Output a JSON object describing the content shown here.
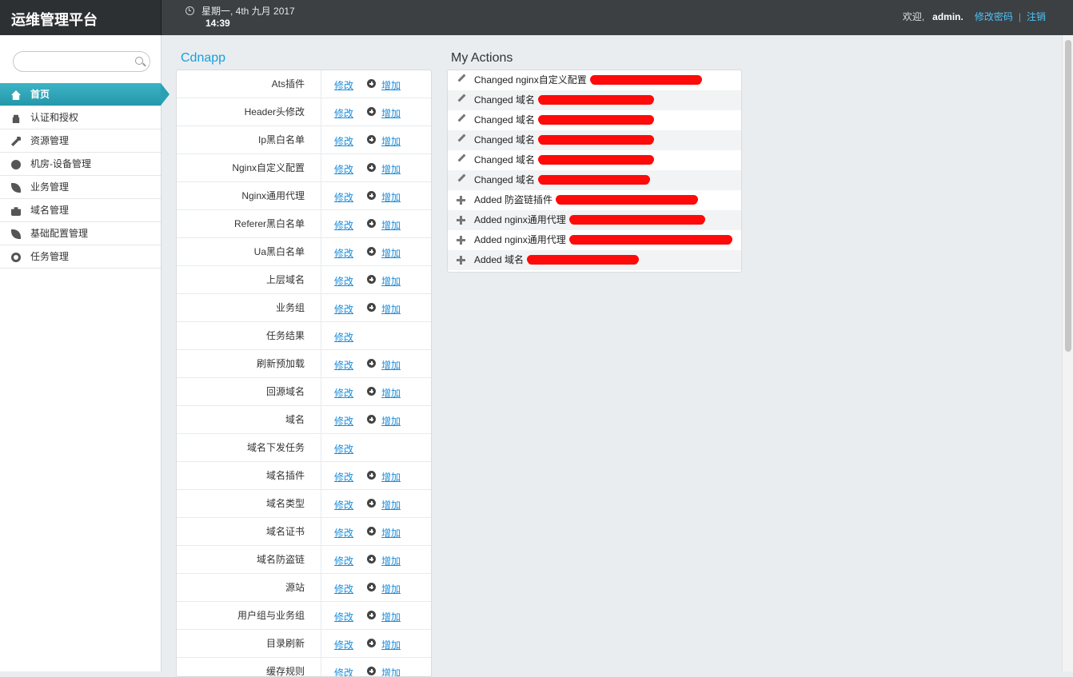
{
  "app": {
    "title": "运维管理平台"
  },
  "header": {
    "date": "星期一, 4th 九月 2017",
    "time": "14:39",
    "welcome": "欢迎,",
    "username": "admin.",
    "change_password": "修改密码",
    "separator": "|",
    "logout": "注销"
  },
  "search": {
    "placeholder": ""
  },
  "sidebar": {
    "items": [
      {
        "label": "首页",
        "icon": "home-icon",
        "active": true
      },
      {
        "label": "认证和授权",
        "icon": "lock-icon"
      },
      {
        "label": "资源管理",
        "icon": "wrench-icon"
      },
      {
        "label": "机房-设备管理",
        "icon": "globe-icon"
      },
      {
        "label": "业务管理",
        "icon": "leaf-icon"
      },
      {
        "label": "域名管理",
        "icon": "briefcase-icon"
      },
      {
        "label": "基础配置管理",
        "icon": "leaf-icon"
      },
      {
        "label": "任务管理",
        "icon": "gear-icon"
      }
    ]
  },
  "cdnapp": {
    "title": "Cdnapp",
    "edit_label": "修改",
    "add_label": "增加",
    "rows": [
      {
        "name": "Ats插件",
        "has_add": true
      },
      {
        "name": "Header头修改",
        "has_add": true
      },
      {
        "name": "Ip黑白名单",
        "has_add": true
      },
      {
        "name": "Nginx自定义配置",
        "has_add": true
      },
      {
        "name": "Nginx通用代理",
        "has_add": true
      },
      {
        "name": "Referer黑白名单",
        "has_add": true
      },
      {
        "name": "Ua黑白名单",
        "has_add": true
      },
      {
        "name": "上层域名",
        "has_add": true
      },
      {
        "name": "业务组",
        "has_add": true
      },
      {
        "name": "任务结果",
        "has_add": false
      },
      {
        "name": "刷新预加载",
        "has_add": true
      },
      {
        "name": "回源域名",
        "has_add": true
      },
      {
        "name": "域名",
        "has_add": true
      },
      {
        "name": "域名下发任务",
        "has_add": false
      },
      {
        "name": "域名插件",
        "has_add": true
      },
      {
        "name": "域名类型",
        "has_add": true
      },
      {
        "name": "域名证书",
        "has_add": true
      },
      {
        "name": "域名防盗链",
        "has_add": true
      },
      {
        "name": "源站",
        "has_add": true
      },
      {
        "name": "用户组与业务组",
        "has_add": true
      },
      {
        "name": "目录刷新",
        "has_add": true
      },
      {
        "name": "缓存规则",
        "has_add": true
      }
    ]
  },
  "actions": {
    "title": "My Actions",
    "items": [
      {
        "type": "changed",
        "text": "Changed nginx自定义配置"
      },
      {
        "type": "changed",
        "text": "Changed 域名"
      },
      {
        "type": "changed",
        "text": "Changed 域名"
      },
      {
        "type": "changed",
        "text": "Changed 域名"
      },
      {
        "type": "changed",
        "text": "Changed 域名"
      },
      {
        "type": "changed",
        "text": "Changed 域名"
      },
      {
        "type": "added",
        "text": "Added 防盗链插件"
      },
      {
        "type": "added",
        "text": "Added nginx通用代理"
      },
      {
        "type": "added",
        "text": "Added nginx通用代理"
      },
      {
        "type": "added",
        "text": "Added 域名"
      }
    ]
  },
  "colors": {
    "accent": "#1a9fd8",
    "active_nav": "#2aa0b3",
    "header": "#3c4043",
    "redaction": "#ff0a0a"
  }
}
